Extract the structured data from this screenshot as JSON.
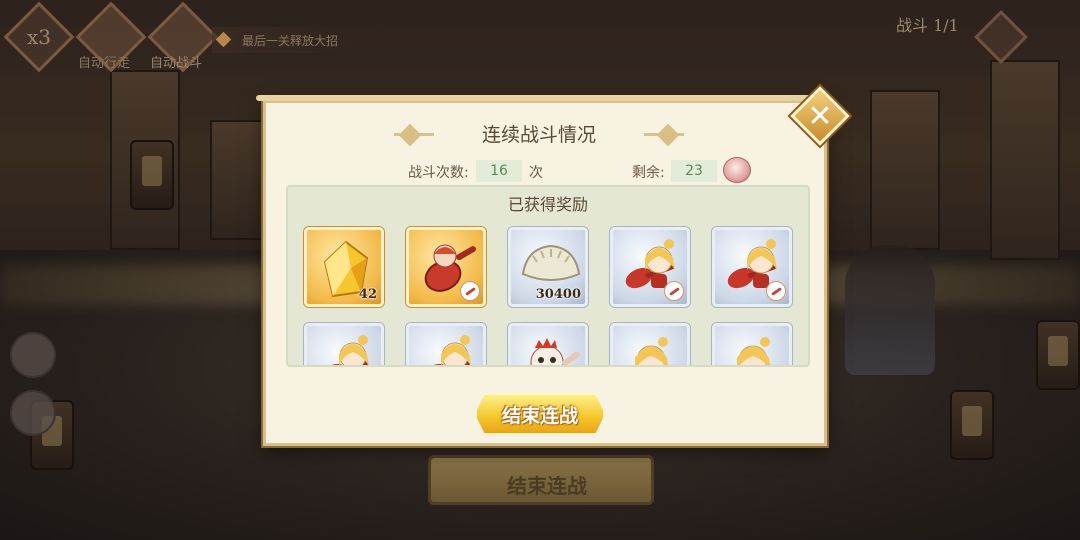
{
  "hud": {
    "speed_label": "x3",
    "auto_move_label": "自动行走",
    "auto_battle_label": "自动战斗",
    "tip_text": "最后一关释放大招",
    "battle_counter": "战斗 1/1",
    "bg_end_button_label": "结束连战"
  },
  "modal": {
    "title": "连续战斗情况",
    "battles_label": "战斗次数:",
    "battles_value": "16",
    "battles_unit": "次",
    "remaining_label": "剩余:",
    "remaining_value": "23",
    "remaining_icon": "steamed-bun-icon",
    "rewards_title": "已获得奖励",
    "end_button_label": "结束连战",
    "rewards": [
      {
        "type": "gold-crystal",
        "rarity": "gold",
        "qty": "42"
      },
      {
        "type": "red-spoon-character",
        "rarity": "gold",
        "qty": ""
      },
      {
        "type": "dumpling",
        "rarity": "blue",
        "qty": "30400"
      },
      {
        "type": "blonde-character-spoon",
        "rarity": "blue",
        "qty": ""
      },
      {
        "type": "blonde-character-spoon",
        "rarity": "blue",
        "qty": ""
      },
      {
        "type": "blonde-character-spoon",
        "rarity": "blue",
        "qty": ""
      },
      {
        "type": "blonde-character-spoon",
        "rarity": "blue",
        "qty": ""
      },
      {
        "type": "rooster-character",
        "rarity": "blue",
        "qty": ""
      },
      {
        "type": "blonde-character",
        "rarity": "blue",
        "qty": ""
      },
      {
        "type": "blonde-character",
        "rarity": "blue",
        "qty": ""
      }
    ]
  },
  "colors": {
    "panel": "#f7f2e1",
    "accent_gold": "#f4c529",
    "value_green": "#5a8a58"
  }
}
